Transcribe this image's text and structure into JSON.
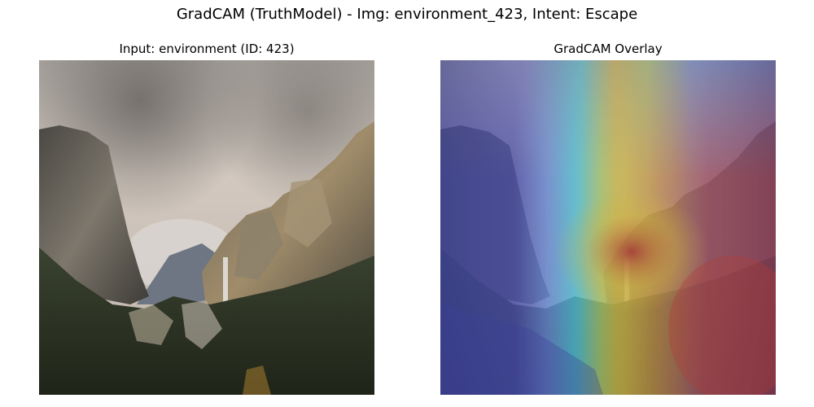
{
  "figure": {
    "title": "GradCAM (TruthModel) - Img: environment_423, Intent: Escape"
  },
  "panels": [
    {
      "title": "Input: environment (ID: 423)"
    },
    {
      "title": "GradCAM Overlay"
    }
  ],
  "colors": {
    "background": "#ffffff",
    "sky": "#c9c0b8",
    "cliff": "#6f6a62",
    "forest": "#2f3726",
    "heat_hot": "#c0392b",
    "heat_warm": "#e3c03a",
    "heat_cool": "#4fd0e0",
    "heat_cold": "#3b3f9a"
  }
}
